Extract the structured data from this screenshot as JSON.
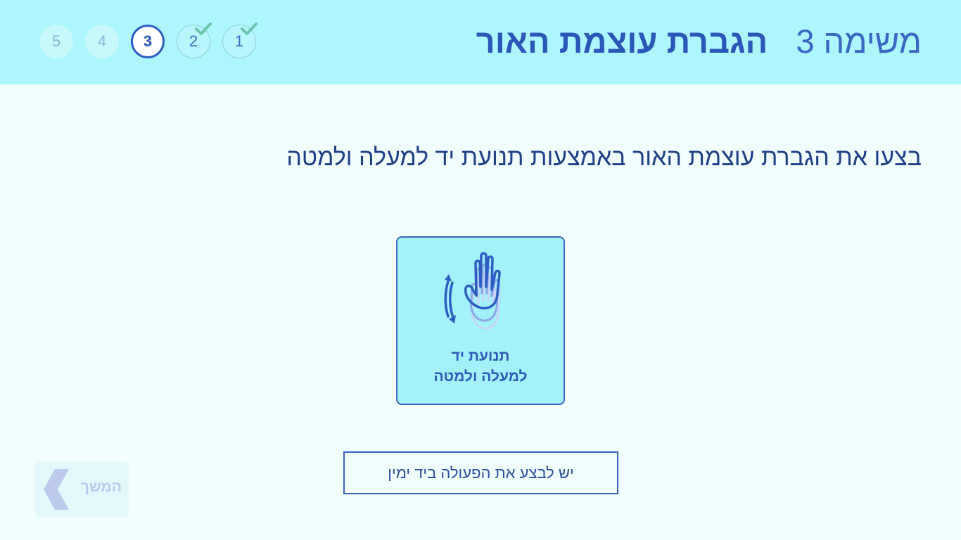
{
  "header": {
    "task_number": "משימה 3",
    "task_name": "הגברת עוצמת האור",
    "steps": [
      {
        "label": "1",
        "state": "done"
      },
      {
        "label": "2",
        "state": "done"
      },
      {
        "label": "3",
        "state": "current"
      },
      {
        "label": "4",
        "state": "todo"
      },
      {
        "label": "5",
        "state": "todo"
      }
    ]
  },
  "main": {
    "instruction": "בצעו את הגברת עוצמת האור באמצעות תנועת יד למעלה ולמטה",
    "gesture_card": {
      "label_line1": "תנועת יד",
      "label_line2": "למעלה ולמטה",
      "icon": "hand-up-down-icon"
    },
    "hint": "יש לבצע את הפעולה ביד ימין"
  },
  "footer": {
    "continue_label": "המשך",
    "continue_icon": "chevron-left-icon"
  },
  "colors": {
    "header_bg": "#adf6fd",
    "page_bg": "#f2fdfe",
    "accent": "#2e5ec2",
    "check": "#6cc3b0",
    "card_bg": "#a2f1fb"
  }
}
